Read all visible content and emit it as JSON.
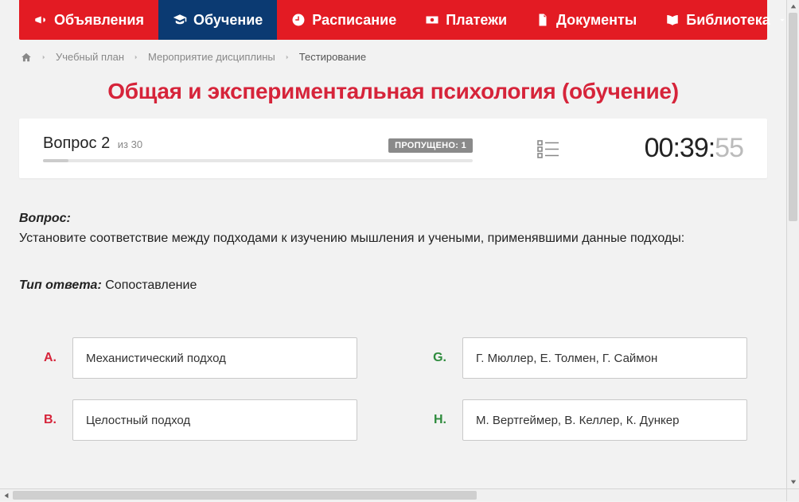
{
  "nav": {
    "items": [
      {
        "label": "Объявления"
      },
      {
        "label": "Обучение"
      },
      {
        "label": "Расписание"
      },
      {
        "label": "Платежи"
      },
      {
        "label": "Документы"
      },
      {
        "label": "Библиотека"
      }
    ]
  },
  "breadcrumb": {
    "items": [
      {
        "label": "Учебный план"
      },
      {
        "label": "Мероприятие дисциплины"
      },
      {
        "label": "Тестирование"
      }
    ]
  },
  "course_title": "Общая и экспериментальная психология (обучение)",
  "quiz_header": {
    "question_word": "Вопрос",
    "question_number": "2",
    "total_prefix": "из",
    "total": "30",
    "skipped_label": "ПРОПУЩЕНО: 1",
    "timer_main": "00:39:",
    "timer_sec": "55"
  },
  "question": {
    "label": "Вопрос:",
    "text": "Установите соответствие между подходами к изучению мышления и учеными, применявшими данные подходы:",
    "answer_type_label": "Тип ответа:",
    "answer_type": "Сопоставление"
  },
  "match": {
    "left": [
      {
        "key": "A.",
        "text": "Механистический подход"
      },
      {
        "key": "B.",
        "text": "Целостный подход"
      }
    ],
    "right": [
      {
        "key": "G.",
        "text": "Г. Мюллер, Е. Толмен, Г. Саймон"
      },
      {
        "key": "H.",
        "text": "М. Вертгеймер, В. Келлер, К. Дункер"
      }
    ]
  }
}
